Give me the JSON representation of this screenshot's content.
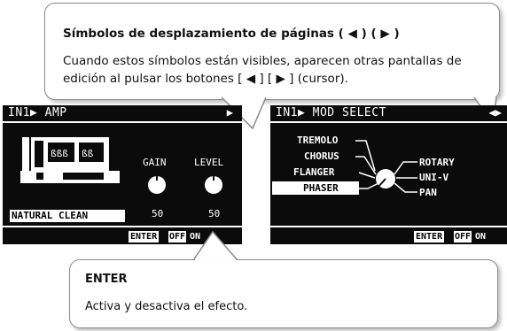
{
  "callout_top": {
    "title": "Símbolos de desplazamiento de páginas ( ◀ ) ( ▶ )",
    "body": "Cuando estos símbolos están visibles, aparecen otras pantallas de edición al pulsar los botones [ ◀ ] [ ▶ ] (cursor)."
  },
  "callout_bottom": {
    "title": "ENTER",
    "body": "Activa y desactiva el efecto."
  },
  "lcd_amp": {
    "title": "IN1▶ AMP",
    "page_arrow": "▶",
    "amp_name": "NATURAL CLEAN",
    "knobs": [
      {
        "label": "GAIN",
        "value": "50"
      },
      {
        "label": "LEVEL",
        "value": "50"
      }
    ],
    "enter_label": "ENTER",
    "off_label": "OFF",
    "on_label": "ON"
  },
  "lcd_mod": {
    "title": "IN1▶ MOD SELECT",
    "page_arrows": "◀▶",
    "left_items": [
      "TREMOLO",
      "CHORUS",
      "FLANGER",
      "PHASER"
    ],
    "right_items": [
      "ROTARY",
      "UNI-V",
      "PAN"
    ],
    "selected_item": "PHASER",
    "enter_label": "ENTER",
    "off_label": "OFF",
    "on_label": "ON"
  }
}
